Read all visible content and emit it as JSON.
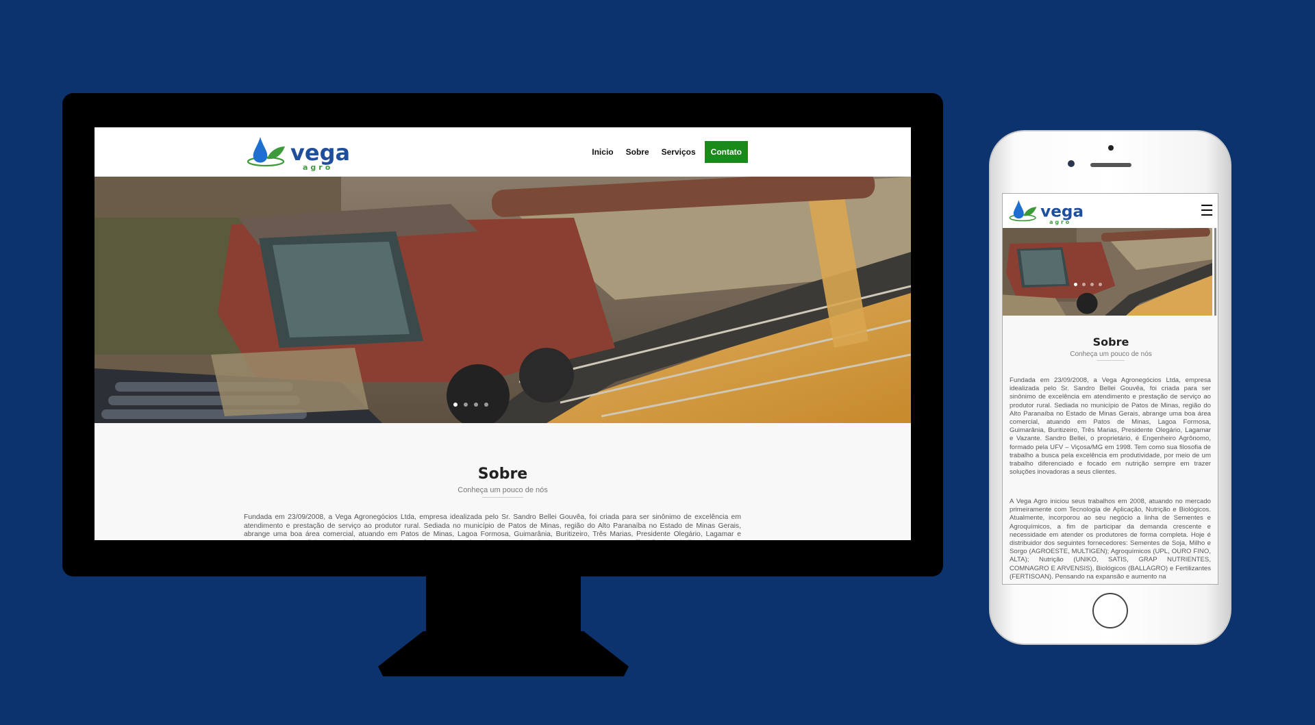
{
  "brand": {
    "name": "vega",
    "tagline": "agro"
  },
  "colors": {
    "background": "#0d336e",
    "accent": "#1a8a1a",
    "logo_blue": "#1f4e9c",
    "logo_green": "#3d9a3a"
  },
  "nav": {
    "items": [
      "Inicio",
      "Sobre",
      "Serviços"
    ],
    "cta": "Contato",
    "mobile_menu_icon": "hamburger-icon"
  },
  "slider": {
    "dots": 4,
    "active_index": 0
  },
  "about": {
    "title": "Sobre",
    "subtitle": "Conheça um pouco de nós",
    "paragraph1": "Fundada em 23/09/2008, a Vega Agronegócios Ltda, empresa idealizada pelo Sr. Sandro Bellei Gouvêa, foi criada para ser sinônimo de excelência em atendimento e prestação de serviço ao produtor rural. Sediada no município de Patos de Minas, região do Alto Paranaíba no Estado de Minas Gerais, abrange uma boa área comercial, atuando em Patos de Minas, Lagoa Formosa, Guimarânia, Buritizeiro, Três Marias, Presidente Olegário, Lagamar e Vazante. Sandro Bellei, o proprietário, é Engenheiro Agrônomo, formado pela UFV – Viçosa/MG em 1998. Tem como sua filosofia de trabalho a busca pela excelência em produtividade, por meio de um trabalho diferenciado e focado em nutrição sempre em trazer soluções inovadoras a seus clientes.",
    "paragraph2": "A Vega Agro iniciou seus trabalhos em 2008, atuando no mercado primeiramente com Tecnologia de Aplicação, Nutrição e Biológicos. Atualmente, incorporou ao seu negócio a linha de Sementes e Agroquímicos, a fim de participar da demanda crescente e necessidade em atender os produtores de forma completa. Hoje é distribuidor dos seguintes fornecedores: Sementes de Soja, Milho e Sorgo (AGROESTE, MULTIGEN); Agroquímicos (UPL, OURO FINO, ALTA); Nutrição (UNIKO, SATIS, GRAP NUTRIENTES, COMNAGRO E ARVENSIS), Biológicos (BALLAGRO) e Fertilizantes (FERTISOAN). Pensando na expansão e aumento na"
  }
}
